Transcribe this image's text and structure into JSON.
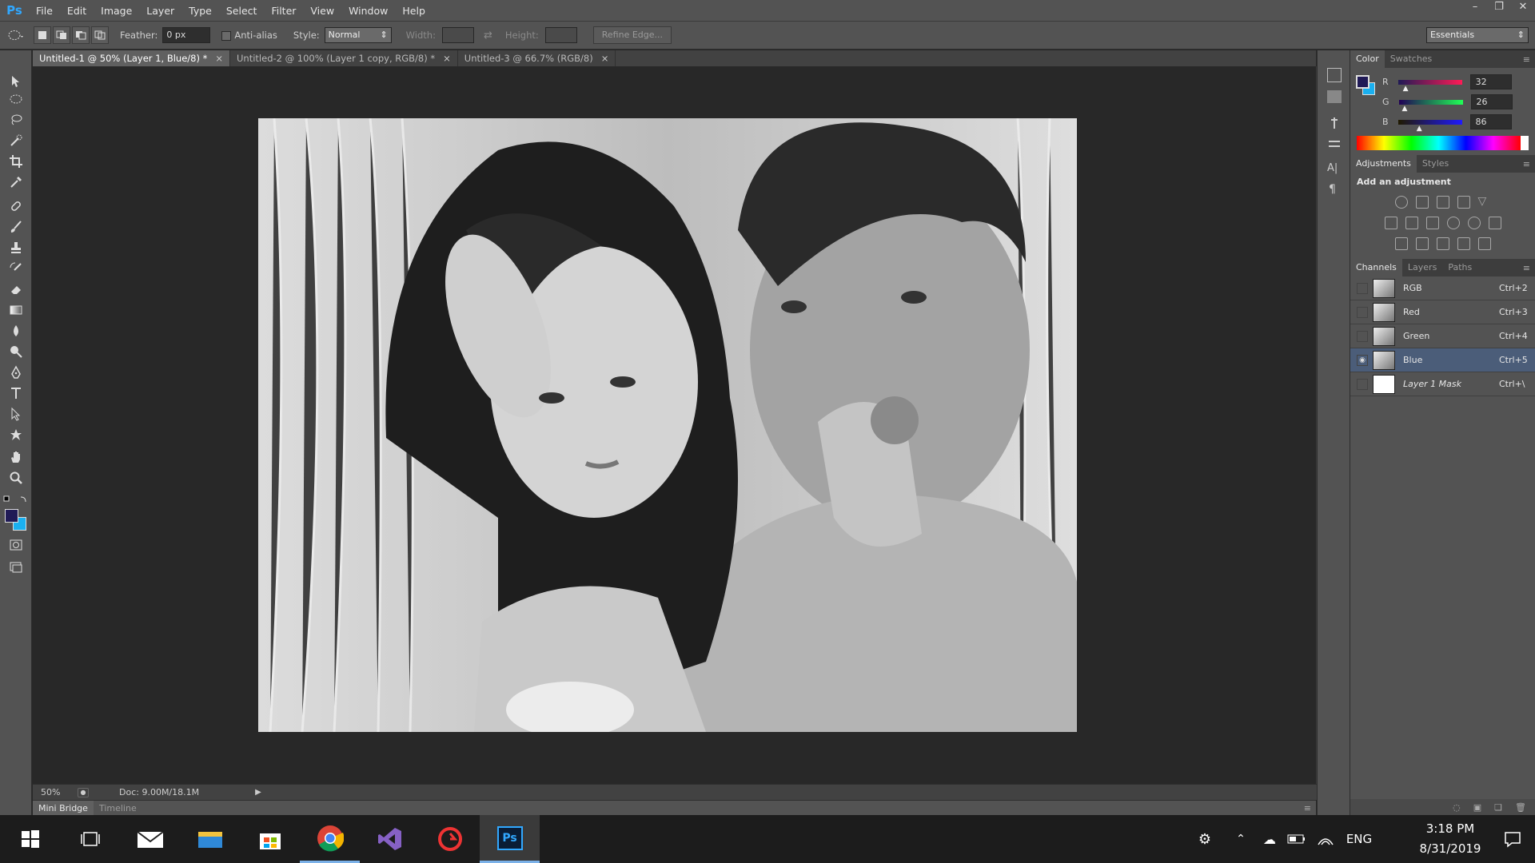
{
  "app": {
    "logo": "Ps",
    "workspace": "Essentials"
  },
  "menu": [
    "File",
    "Edit",
    "Image",
    "Layer",
    "Type",
    "Select",
    "Filter",
    "View",
    "Window",
    "Help"
  ],
  "window_controls": [
    "minimize-icon",
    "restore-icon",
    "close-icon"
  ],
  "options": {
    "feather_label": "Feather:",
    "feather_value": "0 px",
    "antialias_label": "Anti-alias",
    "style_label": "Style:",
    "style_value": "Normal",
    "width_label": "Width:",
    "height_label": "Height:",
    "refine_edge": "Refine Edge..."
  },
  "tabs": [
    {
      "label": "Untitled-1 @ 50% (Layer 1, Blue/8) *",
      "active": true
    },
    {
      "label": "Untitled-2 @ 100% (Layer 1 copy, RGB/8) *",
      "active": false
    },
    {
      "label": "Untitled-3 @ 66.7% (RGB/8)",
      "active": false
    }
  ],
  "status": {
    "zoom": "50%",
    "doc": "Doc: 9.00M/18.1M"
  },
  "bottom_tabs": [
    "Mini Bridge",
    "Timeline"
  ],
  "color_panel": {
    "tabs": [
      "Color",
      "Swatches"
    ],
    "foreground": "#201a56",
    "background": "#1ab0f0",
    "channels": [
      {
        "label": "R",
        "value": "32",
        "fraction": 0.125
      },
      {
        "label": "G",
        "value": "26",
        "fraction": 0.1
      },
      {
        "label": "B",
        "value": "86",
        "fraction": 0.34
      }
    ]
  },
  "adjustments_panel": {
    "tabs": [
      "Adjustments",
      "Styles"
    ],
    "heading": "Add an adjustment"
  },
  "channels_panel": {
    "tabs": [
      "Channels",
      "Layers",
      "Paths"
    ],
    "rows": [
      {
        "name": "RGB",
        "shortcut": "Ctrl+2",
        "visible": false,
        "selected": false
      },
      {
        "name": "Red",
        "shortcut": "Ctrl+3",
        "visible": false,
        "selected": false
      },
      {
        "name": "Green",
        "shortcut": "Ctrl+4",
        "visible": false,
        "selected": false
      },
      {
        "name": "Blue",
        "shortcut": "Ctrl+5",
        "visible": true,
        "selected": true
      },
      {
        "name": "Layer 1 Mask",
        "shortcut": "Ctrl+\\",
        "visible": false,
        "selected": false
      }
    ]
  },
  "taskbar": {
    "language": "ENG",
    "time": "3:18 PM",
    "date": "8/31/2019"
  }
}
